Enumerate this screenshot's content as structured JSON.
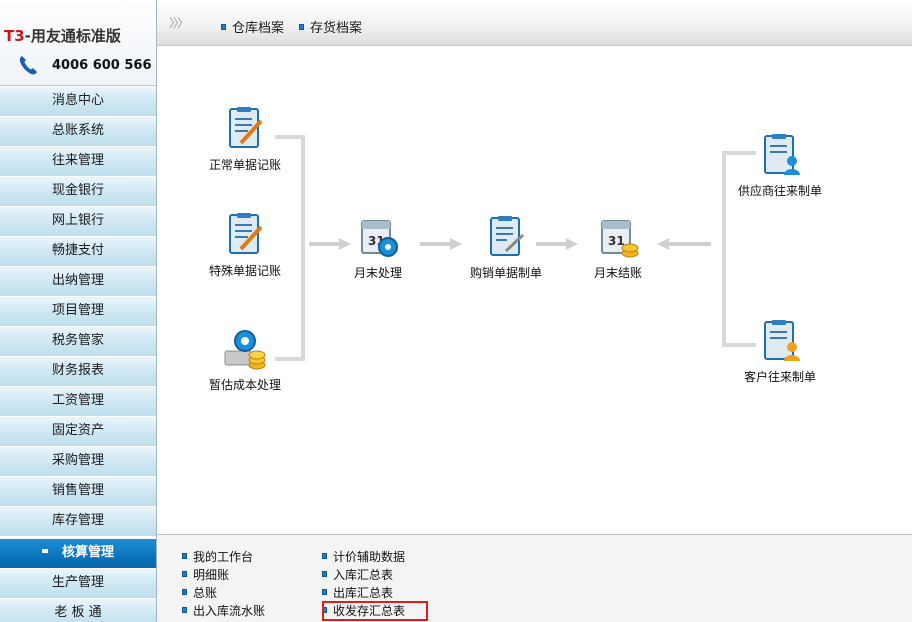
{
  "brand": {
    "product_prefix": "T3",
    "product_name": "-用友通标准版",
    "hotline": "4006 600 566"
  },
  "sidebar": {
    "items": [
      {
        "label": "消息中心"
      },
      {
        "label": "总账系统"
      },
      {
        "label": "往来管理"
      },
      {
        "label": "现金银行"
      },
      {
        "label": "网上银行"
      },
      {
        "label": "畅捷支付"
      },
      {
        "label": "出纳管理"
      },
      {
        "label": "项目管理"
      },
      {
        "label": "税务管家"
      },
      {
        "label": "财务报表"
      },
      {
        "label": "工资管理"
      },
      {
        "label": "固定资产"
      },
      {
        "label": "采购管理"
      },
      {
        "label": "销售管理"
      },
      {
        "label": "库存管理"
      },
      {
        "label": "核算管理",
        "active": true
      },
      {
        "label": "生产管理"
      },
      {
        "label": "老 板 通"
      }
    ]
  },
  "topbar": {
    "collapse_glyph": "〉〉〉",
    "links": [
      {
        "label": "仓库档案"
      },
      {
        "label": "存货档案"
      }
    ]
  },
  "diagram": {
    "nodes": {
      "normal_bill": "正常单据记账",
      "special_bill": "特殊单据记账",
      "estimate_cost": "暂估成本处理",
      "month_end_process": "月末处理",
      "purchase_sales_voucher": "购销单据制单",
      "month_end_close": "月末结账",
      "supplier_voucher": "供应商往来制单",
      "customer_voucher": "客户往来制单"
    }
  },
  "bottom": {
    "col1": [
      {
        "label": "我的工作台"
      },
      {
        "label": "明细账"
      },
      {
        "label": "总账"
      },
      {
        "label": "出入库流水账"
      }
    ],
    "col2": [
      {
        "label": "计价辅助数据"
      },
      {
        "label": "入库汇总表"
      },
      {
        "label": "出库汇总表"
      },
      {
        "label": "收发存汇总表",
        "highlighted": true
      }
    ]
  },
  "colors": {
    "brand_red": "#c8161d",
    "nav_active": "#0b74bd",
    "nav_bg": "#cde7f3",
    "highlight": "#e21b1b"
  },
  "icons": [
    "phone-icon",
    "document-pen-icon",
    "gear-coins-icon",
    "calendar-gear-icon",
    "clipboard-pen-icon",
    "calendar-close-icon",
    "clipboard-person-icon"
  ]
}
